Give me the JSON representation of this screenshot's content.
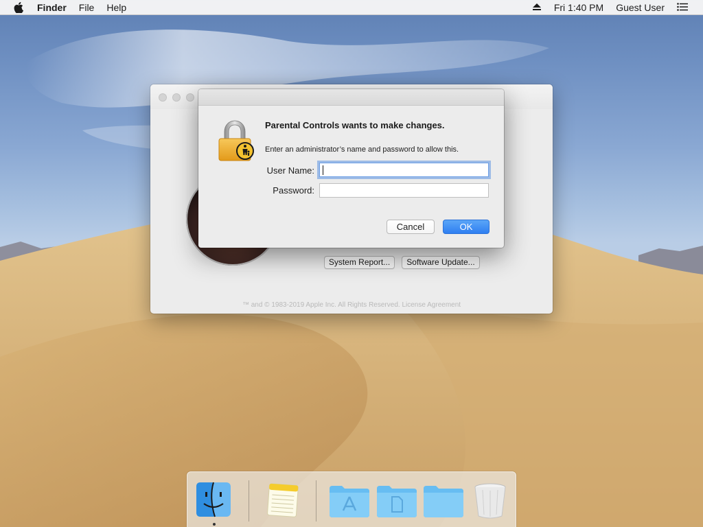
{
  "menubar": {
    "apple_icon": "apple-icon",
    "app_name": "Finder",
    "menus": [
      "File",
      "Help"
    ],
    "eject_icon": "eject-icon",
    "clock": "Fri 1:40 PM",
    "user": "Guest User",
    "list_icon": "list-icon"
  },
  "about_window": {
    "buttons": {
      "system_report": "System Report...",
      "software_update": "Software Update..."
    },
    "footer": "™ and © 1983-2019 Apple Inc. All Rights Reserved. License Agreement"
  },
  "auth_dialog": {
    "icon": "lock-parental-icon",
    "title": "Parental Controls wants to make changes.",
    "message": "Enter an administrator’s name and password to allow this.",
    "user_label": "User Name:",
    "user_value": "",
    "password_label": "Password:",
    "password_value": "",
    "cancel_label": "Cancel",
    "ok_label": "OK"
  },
  "dock": {
    "items": [
      "finder-icon",
      "notes-icon",
      "applications-folder-icon",
      "documents-folder-icon",
      "downloads-folder-icon",
      "trash-icon"
    ]
  },
  "colors": {
    "accent": "#2f7ff1",
    "focus_ring": "#5c94e2"
  }
}
